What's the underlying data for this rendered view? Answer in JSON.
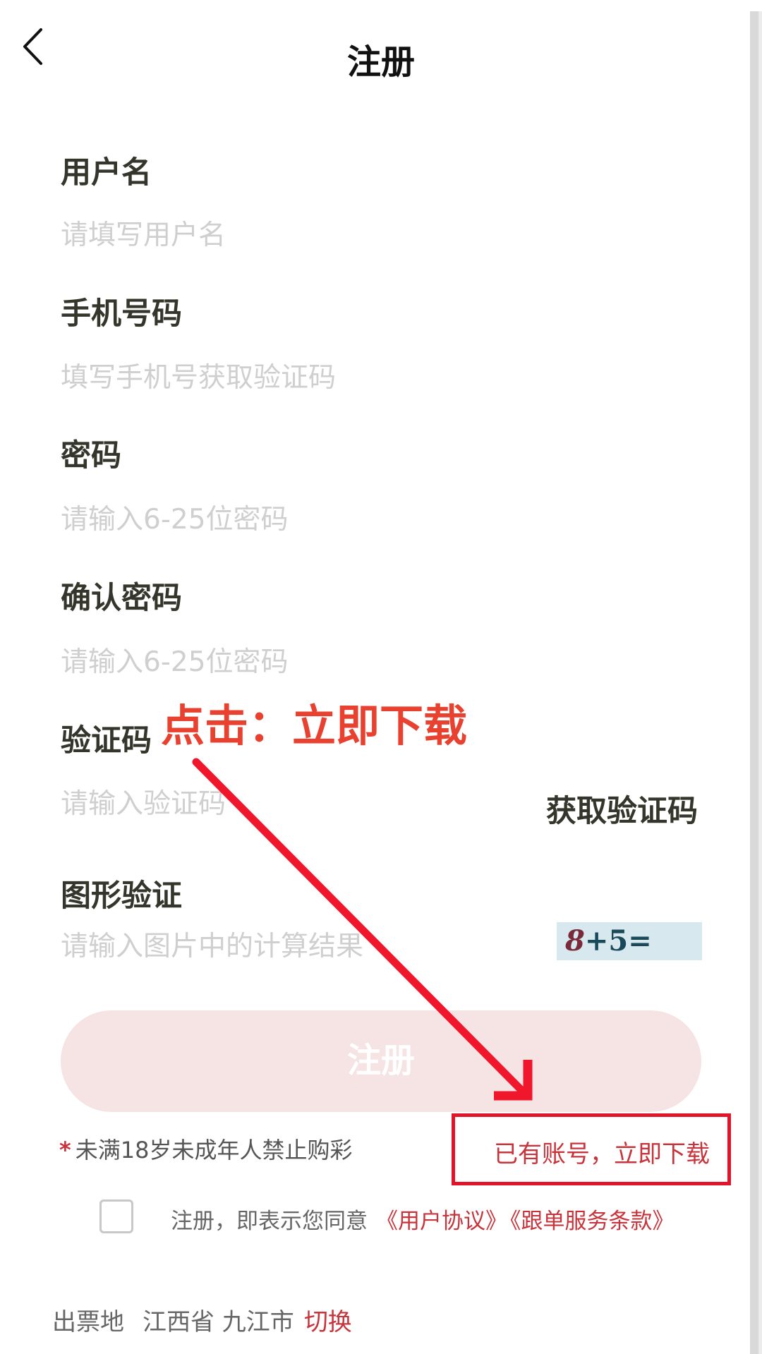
{
  "header": {
    "title": "注册",
    "back_icon": "chevron-left-icon"
  },
  "form": {
    "username": {
      "label": "用户名",
      "placeholder": "请填写用户名"
    },
    "phone": {
      "label": "手机号码",
      "placeholder": "填写手机号获取验证码"
    },
    "password": {
      "label": "密码",
      "placeholder": "请输入6-25位密码"
    },
    "confirm_password": {
      "label": "确认密码",
      "placeholder": "请输入6-25位密码"
    },
    "sms_code": {
      "label": "验证码",
      "placeholder": "请输入验证码",
      "get_code_label": "获取验证码"
    },
    "captcha": {
      "label": "图形验证",
      "placeholder": "请输入图片中的计算结果",
      "num1": "8",
      "rest": "+5="
    }
  },
  "register_button": {
    "label": "注册",
    "color": "#f6e3e3"
  },
  "notice": {
    "star": "*",
    "text": "未满18岁未成年人禁止购彩"
  },
  "login_link": {
    "label": "已有账号，立即下载"
  },
  "agreement": {
    "text": "注册，即表示您同意",
    "user_agreement": "《用户协议》",
    "service_terms": "《跟单服务条款》"
  },
  "location": {
    "label": "出票地",
    "province_city": "江西省 九江市",
    "switch_label": "切换"
  },
  "annotation": {
    "text": "点击：立即下载",
    "color": "#e3142a"
  },
  "colors": {
    "accent": "#c8343b",
    "label": "#34362b",
    "placeholder": "#cfcfcf"
  }
}
